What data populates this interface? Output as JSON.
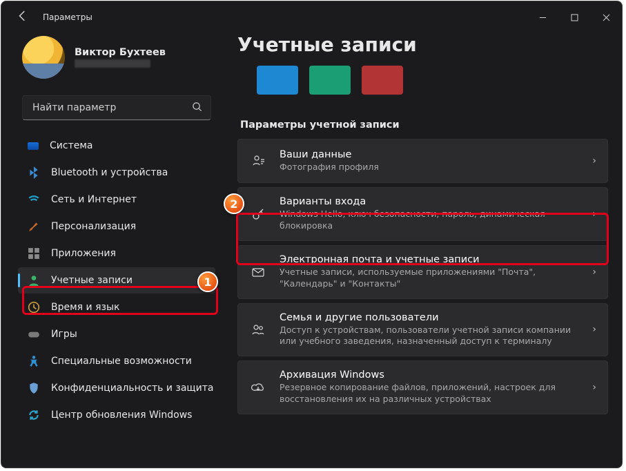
{
  "window": {
    "title": "Параметры"
  },
  "profile": {
    "name": "Виктор Бухтеев"
  },
  "search": {
    "placeholder": "Найти параметр"
  },
  "sidebar": {
    "items": [
      {
        "label": "Система"
      },
      {
        "label": "Bluetooth и устройства"
      },
      {
        "label": "Сеть и Интернет"
      },
      {
        "label": "Персонализация"
      },
      {
        "label": "Приложения"
      },
      {
        "label": "Учетные записи"
      },
      {
        "label": "Время и язык"
      },
      {
        "label": "Игры"
      },
      {
        "label": "Специальные возможности"
      },
      {
        "label": "Конфиденциальность и защита"
      },
      {
        "label": "Центр обновления Windows"
      }
    ]
  },
  "page": {
    "title": "Учетные записи",
    "section_title": "Параметры учетной записи"
  },
  "cards": [
    {
      "title": "Ваши данные",
      "sub": "Фотография профиля"
    },
    {
      "title": "Варианты входа",
      "sub": "Windows Hello, ключ безопасности, пароль, динамическая блокировка"
    },
    {
      "title": "Электронная почта и учетные записи",
      "sub": "Учетные записи, используемые приложениями \"Почта\", \"Календарь\" и \"Контакты\""
    },
    {
      "title": "Семья и другие пользователи",
      "sub": "Доступ к устройствам, пользователи учетной записи компании или учебного заведения, назначенный доступ к терминалу"
    },
    {
      "title": "Архивация Windows",
      "sub": "Резервное копирование файлов, приложений, настроек для восстановления их на различных устройствах"
    }
  ],
  "markers": {
    "1": "1",
    "2": "2"
  }
}
